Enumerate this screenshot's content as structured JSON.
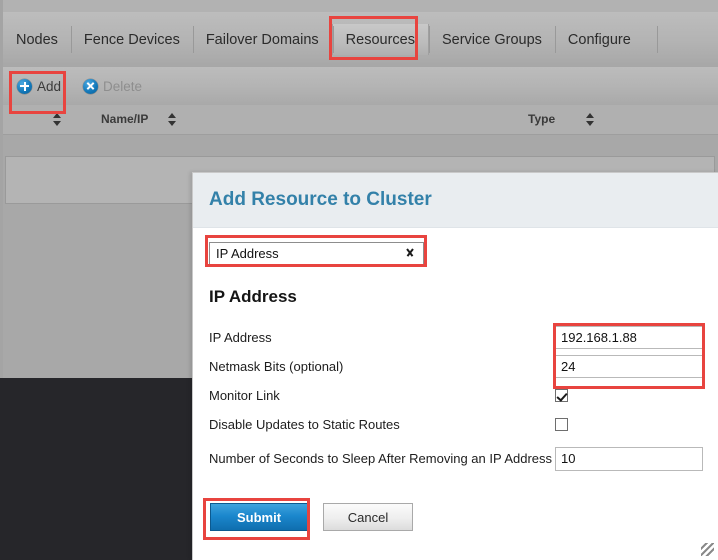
{
  "nav": {
    "tabs": [
      {
        "label": "Nodes",
        "active": false
      },
      {
        "label": "Fence Devices",
        "active": false
      },
      {
        "label": "Failover Domains",
        "active": false
      },
      {
        "label": "Resources",
        "active": true
      },
      {
        "label": "Service Groups",
        "active": false
      },
      {
        "label": "Configure",
        "active": false
      }
    ]
  },
  "toolbar": {
    "add_label": "Add",
    "add_icon": "plus-circle-icon",
    "delete_label": "Delete",
    "delete_icon": "close-circle-icon"
  },
  "table": {
    "columns": [
      {
        "label": ""
      },
      {
        "label": "Name/IP"
      },
      {
        "label": "Type"
      }
    ],
    "sort_icon": "sort-arrows-icon",
    "rows": []
  },
  "dialog": {
    "title": "Add Resource to Cluster",
    "resource_type": {
      "selected": "IP Address",
      "chevron_icon": "chevron-down-icon"
    },
    "section_title": "IP Address",
    "fields": [
      {
        "label": "IP Address",
        "value": "192.168.1.88",
        "type": "text"
      },
      {
        "label": "Netmask Bits (optional)",
        "value": "24",
        "type": "text"
      },
      {
        "label": "Monitor Link",
        "value": "",
        "type": "checkbox",
        "checked": true
      },
      {
        "label": "Disable Updates to Static Routes",
        "value": "",
        "type": "checkbox",
        "checked": false
      },
      {
        "label": "Number of Seconds to Sleep After Removing an IP Address",
        "value": "10",
        "type": "text"
      }
    ],
    "submit_label": "Submit",
    "cancel_label": "Cancel"
  },
  "background": {
    "ghost_text": ""
  },
  "colors": {
    "accent_blue": "#3381a9",
    "button_blue": "#1b87cd",
    "highlight_red": "#e8443f",
    "page_grey": "#a8a8a8",
    "dark_panel": "#26262a"
  }
}
